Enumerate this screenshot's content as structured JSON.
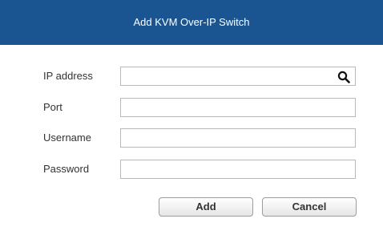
{
  "dialog": {
    "title": "Add KVM Over-IP Switch"
  },
  "form": {
    "fields": [
      {
        "label": "IP address",
        "value": "",
        "placeholder": ""
      },
      {
        "label": "Port",
        "value": "",
        "placeholder": ""
      },
      {
        "label": "Username",
        "value": "",
        "placeholder": ""
      },
      {
        "label": "Password",
        "value": "",
        "placeholder": ""
      }
    ],
    "ip_search_icon": "search-icon"
  },
  "buttons": {
    "add_label": "Add",
    "cancel_label": "Cancel"
  },
  "colors": {
    "title_bar": "#1a5591",
    "title_text": "#ffffff"
  }
}
